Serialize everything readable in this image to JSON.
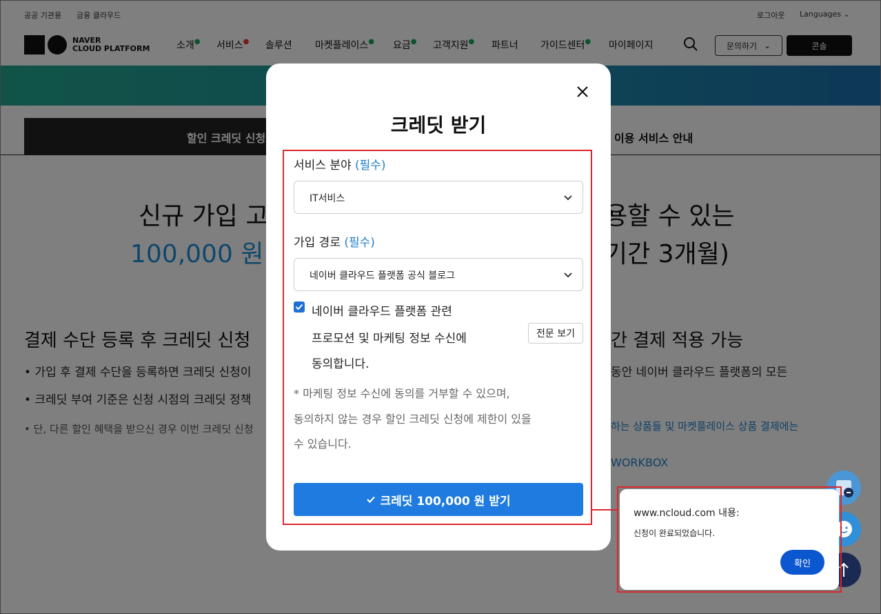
{
  "utility": {
    "public_label": "공공 기관용",
    "finance_label": "금융 클라우드",
    "logout_label": "로그아웃",
    "languages_label": "Languages"
  },
  "nav": {
    "logo_line1": "NAVER",
    "logo_line2": "CLOUD PLATFORM",
    "items": [
      {
        "label": "소개"
      },
      {
        "label": "서비스"
      },
      {
        "label": "솔루션"
      },
      {
        "label": "마켓플레이스"
      },
      {
        "label": "요금"
      },
      {
        "label": "고객지원"
      },
      {
        "label": "파트너"
      },
      {
        "label": "가이드센터"
      },
      {
        "label": "마이페이지"
      }
    ],
    "inquiry_label": "문의하기",
    "console_label": "콘솔"
  },
  "tabs": {
    "active_label": "할인 크레딧 신청",
    "other_label": "이용 서비스 안내"
  },
  "page": {
    "hero_line1_left": "신규 가입 고",
    "hero_line1_right": "용할 수 있는",
    "hero_line2_left": "100,000 원",
    "hero_line2_right": "기간 3개월)",
    "section_left": "결제 수단 등록 후 크레딧 신청",
    "section_right": "간 결제 적용 가능",
    "bullet1_left": "• 가입 후 결제 수단을 등록하면 크레딧 신청이",
    "bullet1_right": "동안 네이버 클라우드 플랫폼의 모든",
    "bullet2_left": "• 크레딧 부여 기준은 신청 시점의 크레딧 정책",
    "bullet3_left": "• 단, 다른 할인 혜택을 받으신 경우 이번 크레딧 신청",
    "bullet3_right": "하는 상품들 및 마켓플레이스 상품 결제에는",
    "workbox": "WORKBOX"
  },
  "modal": {
    "title": "크레딧 받기",
    "field1_label": "서비스 분야",
    "required": "(필수)",
    "field1_value": "IT서비스",
    "field2_label": "가입 경로",
    "field2_value": "네이버 클라우드 플랫폼 공식 블로그",
    "consent_line1": "네이버 클라우드 플랫폼 관련",
    "consent_line2": "프로모션 및 마케팅 정보 수신에",
    "consent_line3": "동의합니다.",
    "consent_checked": true,
    "detail_button": "전문 보기",
    "note_line1": "* 마케팅 정보 수신에 동의를 거부할 수 있으며,",
    "note_line2": "동의하지 않는 경우 할인 크레딧 신청에 제한이 있을",
    "note_line3": "수 있습니다.",
    "submit_label": "크레딧 100,000 원 받기"
  },
  "alert": {
    "title": "www.ncloud.com 내용:",
    "message": "신청이 완료되었습니다.",
    "ok_label": "확인"
  },
  "colors": {
    "accent_blue": "#1f7be0",
    "highlight_red": "#d9262c",
    "alert_button": "#0b57d0"
  }
}
